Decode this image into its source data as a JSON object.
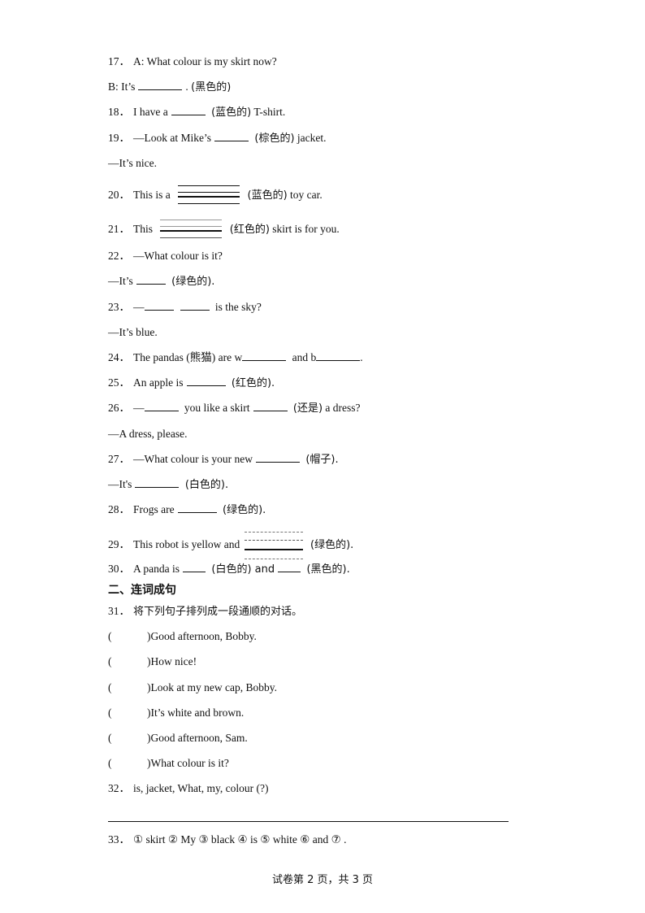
{
  "questions": {
    "q17": {
      "num": "17．",
      "a": "A: What colour is my skirt now?",
      "b_pre": "B: It’s",
      "b_post": ".",
      "hint": "(黑色的)"
    },
    "q18": {
      "num": "18．",
      "pre": "I have a",
      "hint": "(蓝色的)",
      "post": "T-shirt."
    },
    "q19": {
      "num": "19．",
      "pre": "—Look at Mike’s",
      "hint": "(棕色的)",
      "post": "jacket.",
      "reply": "—It’s nice."
    },
    "q20": {
      "num": "20．",
      "pre": "This is a",
      "hint": "(蓝色的)",
      "post": "toy car."
    },
    "q21": {
      "num": "21．",
      "pre": "This",
      "hint": "(红色的)",
      "post": "skirt is for you."
    },
    "q22": {
      "num": "22．",
      "q": "—What colour is it?",
      "reply_pre": "—It’s",
      "hint": "(绿色的)."
    },
    "q23": {
      "num": "23．",
      "pre": "—",
      "post": "is the sky?",
      "reply": "—It’s blue."
    },
    "q24": {
      "num": "24．",
      "pre": "The pandas (熊猫)  are w",
      "mid": "and b",
      "post": "."
    },
    "q25": {
      "num": "25．",
      "pre": "An apple is",
      "hint": "(红色的)."
    },
    "q26": {
      "num": "26．",
      "pre": "—",
      "mid": "you like a skirt",
      "hint": "(还是)",
      "post": "a dress?",
      "reply": "—A dress, please."
    },
    "q27": {
      "num": "27．",
      "pre": "—What colour is your new",
      "hint": "(帽子).",
      "reply_pre": "—It's",
      "reply_hint": "(白色的)."
    },
    "q28": {
      "num": "28．",
      "pre": "Frogs are",
      "hint": "(绿色的)."
    },
    "q29": {
      "num": "29．",
      "pre": "This robot is yellow and",
      "hint": "(绿色的)."
    },
    "q30": {
      "num": "30．",
      "pre": "A panda is",
      "hint1": "(白色的) and",
      "hint2": "(黑色的)."
    }
  },
  "section2": {
    "title": "二、连词成句",
    "q31": {
      "num": "31．",
      "instruction": "将下列句子排列成一段通顺的对话。",
      "items": [
        "Good afternoon, Bobby.",
        "How nice!",
        "Look at my new cap, Bobby.",
        "It’s white and brown.",
        "Good afternoon, Sam.",
        "What colour is it?"
      ]
    },
    "q32": {
      "num": "32．",
      "text": "is, jacket, What, my, colour (?)"
    },
    "q33": {
      "num": "33．",
      "text": "① skirt ② My ③ black ④ is ⑤ white ⑥ and ⑦ ."
    }
  },
  "footer": "试卷第 2 页，共 3 页"
}
